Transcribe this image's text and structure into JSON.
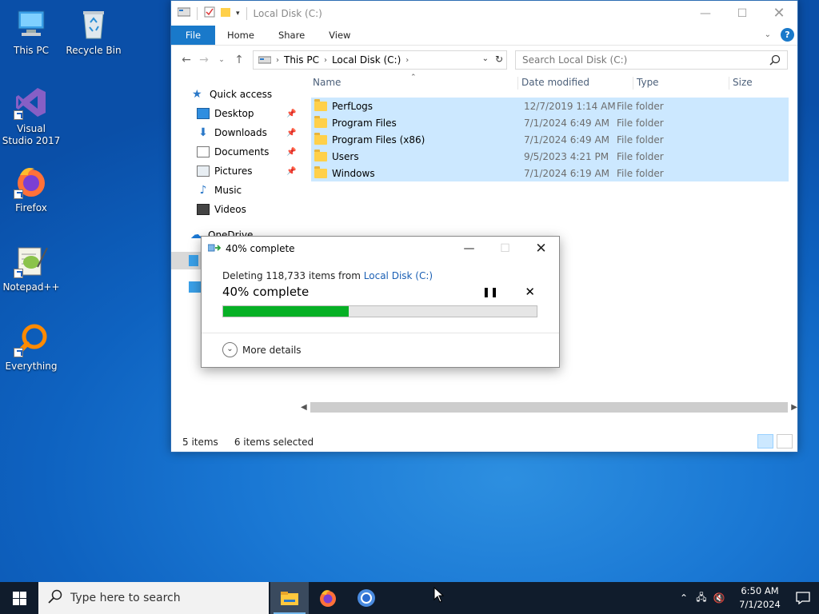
{
  "desktop": {
    "icons": [
      {
        "label": "This PC"
      },
      {
        "label": "Recycle Bin"
      },
      {
        "label": "Visual Studio 2017"
      },
      {
        "label": "Firefox"
      },
      {
        "label": "Notepad++"
      },
      {
        "label": "Everything"
      }
    ]
  },
  "explorer": {
    "title": "Local Disk (C:)",
    "ribbon": {
      "file": "File",
      "tabs": [
        "Home",
        "Share",
        "View"
      ]
    },
    "address": {
      "crumbs": [
        "This PC",
        "Local Disk (C:)"
      ]
    },
    "search": {
      "placeholder": "Search Local Disk (C:)"
    },
    "nav": {
      "quick_access": "Quick access",
      "items": [
        "Desktop",
        "Downloads",
        "Documents",
        "Pictures",
        "Music",
        "Videos"
      ],
      "onedrive": "OneDrive"
    },
    "columns": {
      "name": "Name",
      "date": "Date modified",
      "type": "Type",
      "size": "Size"
    },
    "rows": [
      {
        "name": "PerfLogs",
        "date": "12/7/2019 1:14 AM",
        "type": "File folder"
      },
      {
        "name": "Program Files",
        "date": "7/1/2024 6:49 AM",
        "type": "File folder"
      },
      {
        "name": "Program Files (x86)",
        "date": "7/1/2024 6:49 AM",
        "type": "File folder"
      },
      {
        "name": "Users",
        "date": "9/5/2023 4:21 PM",
        "type": "File folder"
      },
      {
        "name": "Windows",
        "date": "7/1/2024 6:19 AM",
        "type": "File folder"
      }
    ],
    "status": {
      "items": "5 items",
      "selected": "6 items selected"
    }
  },
  "dialog": {
    "title": "40% complete",
    "line_prefix": "Deleting 118,733 items from ",
    "line_link": "Local Disk (C:)",
    "headline": "40% complete",
    "progress": 0.4,
    "more_details": "More details"
  },
  "taskbar": {
    "search_placeholder": "Type here to search",
    "time": "6:50 AM",
    "date": "7/1/2024"
  },
  "colors": {
    "accent": "#1979ca",
    "progress": "#06b025",
    "selection": "#cce8ff",
    "taskbar": "#101c2c"
  }
}
